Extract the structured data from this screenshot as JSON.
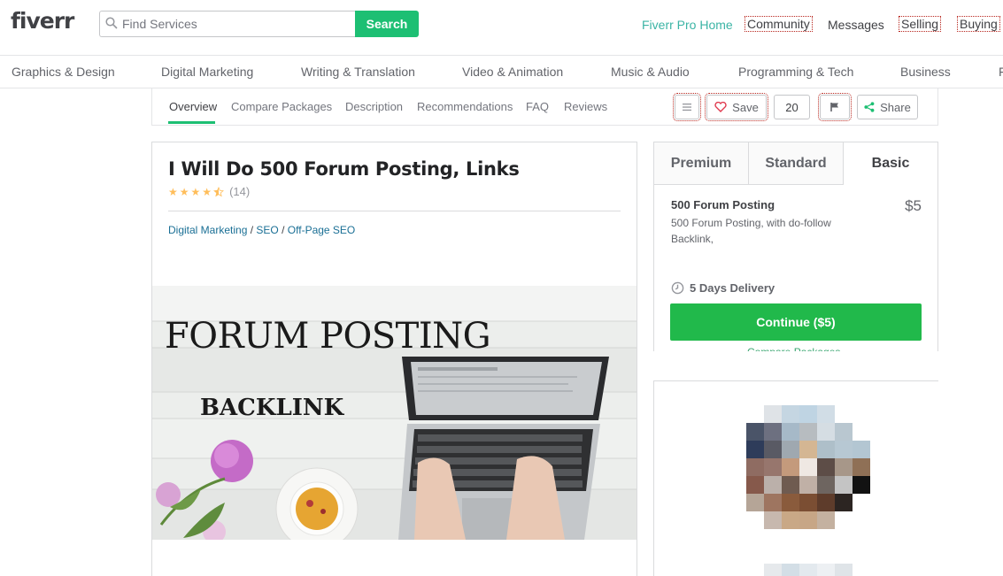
{
  "header": {
    "logo": "fiverr",
    "search_placeholder": "Find Services",
    "search_button": "Search",
    "nav": {
      "pro": "Fiverr Pro Home",
      "community": "Community",
      "messages": "Messages",
      "selling": "Selling",
      "buying": "Buying"
    }
  },
  "categories": [
    "Graphics & Design",
    "Digital Marketing",
    "Writing & Translation",
    "Video & Animation",
    "Music & Audio",
    "Programming & Tech",
    "Business",
    "F"
  ],
  "subnav": {
    "tabs": [
      "Overview",
      "Compare Packages",
      "Description",
      "Recommendations",
      "FAQ",
      "Reviews"
    ],
    "save_label": "Save",
    "save_count": "20",
    "share_label": "Share"
  },
  "gig": {
    "title": "I Will Do 500 Forum Posting, Links",
    "rating": 4.5,
    "rating_count": "(14)",
    "breadcrumb": [
      "Digital Marketing",
      "SEO",
      "Off-Page SEO"
    ],
    "breadcrumb_sep": "/",
    "image_text_1": "FORUM POSTING",
    "image_text_2": "BACKLINK"
  },
  "package": {
    "tabs": [
      "Premium",
      "Standard",
      "Basic"
    ],
    "active_tab": "Basic",
    "name": "500 Forum Posting",
    "price": "$5",
    "description": "500 Forum Posting, with do-follow Backlink,",
    "delivery": "5 Days Delivery",
    "continue_label": "Continue ($5)",
    "compare_label": "Compare Packages"
  },
  "colors": {
    "brand_green": "#1dbf73",
    "link_blue": "#1a6f95",
    "star": "#ffbe5b"
  }
}
